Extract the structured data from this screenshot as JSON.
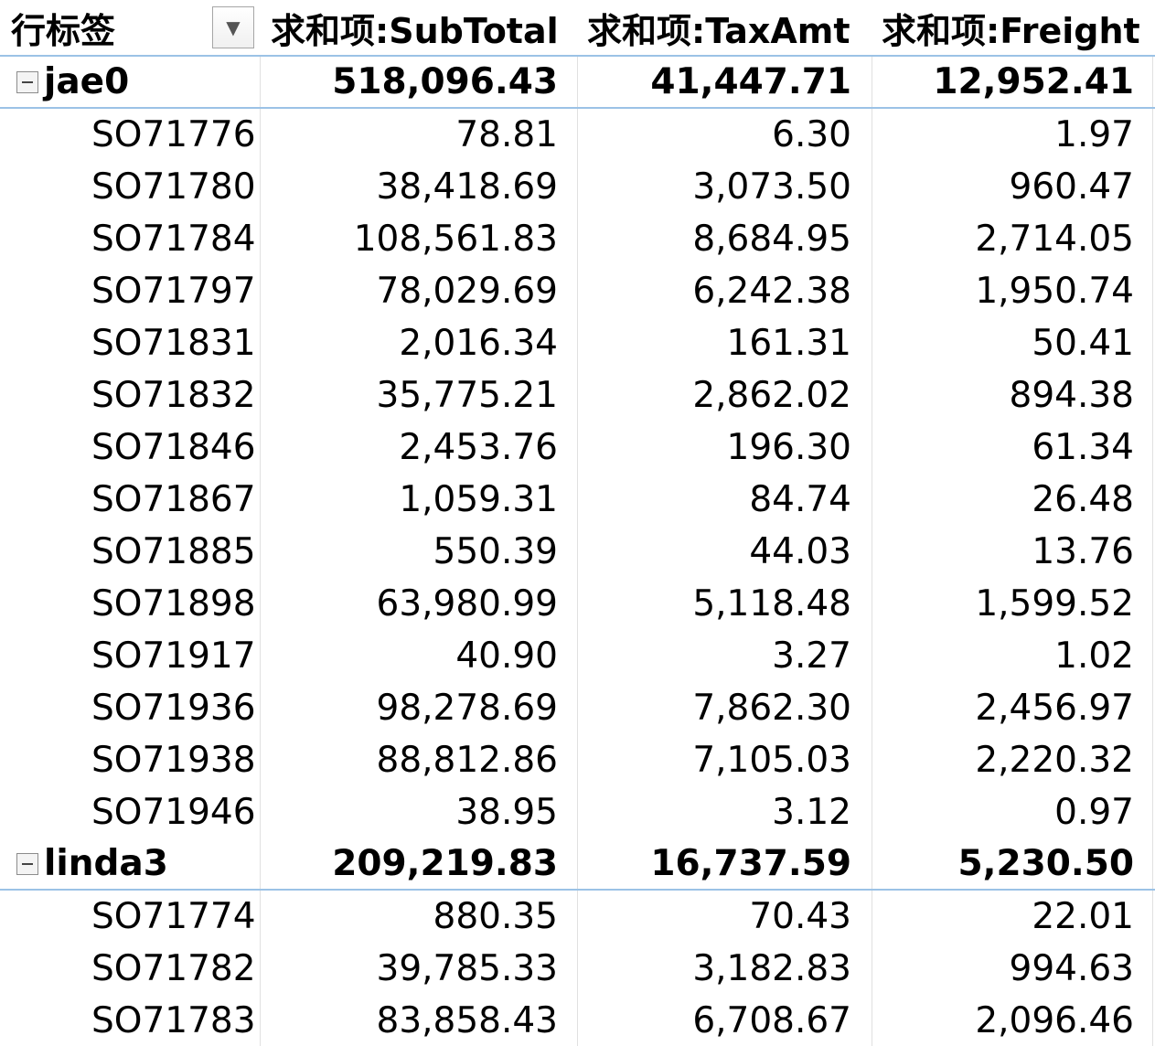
{
  "header": {
    "row_label": "行标签",
    "col1": "求和项:SubTotal",
    "col2": "求和项:TaxAmt",
    "col3": "求和项:Freight"
  },
  "groups": [
    {
      "name": "jae0",
      "subtotal": "518,096.43",
      "tax": "41,447.71",
      "freight": "12,952.41",
      "rows": [
        {
          "id": "SO71776",
          "subtotal": "78.81",
          "tax": "6.30",
          "freight": "1.97"
        },
        {
          "id": "SO71780",
          "subtotal": "38,418.69",
          "tax": "3,073.50",
          "freight": "960.47"
        },
        {
          "id": "SO71784",
          "subtotal": "108,561.83",
          "tax": "8,684.95",
          "freight": "2,714.05"
        },
        {
          "id": "SO71797",
          "subtotal": "78,029.69",
          "tax": "6,242.38",
          "freight": "1,950.74"
        },
        {
          "id": "SO71831",
          "subtotal": "2,016.34",
          "tax": "161.31",
          "freight": "50.41"
        },
        {
          "id": "SO71832",
          "subtotal": "35,775.21",
          "tax": "2,862.02",
          "freight": "894.38"
        },
        {
          "id": "SO71846",
          "subtotal": "2,453.76",
          "tax": "196.30",
          "freight": "61.34"
        },
        {
          "id": "SO71867",
          "subtotal": "1,059.31",
          "tax": "84.74",
          "freight": "26.48"
        },
        {
          "id": "SO71885",
          "subtotal": "550.39",
          "tax": "44.03",
          "freight": "13.76"
        },
        {
          "id": "SO71898",
          "subtotal": "63,980.99",
          "tax": "5,118.48",
          "freight": "1,599.52"
        },
        {
          "id": "SO71917",
          "subtotal": "40.90",
          "tax": "3.27",
          "freight": "1.02"
        },
        {
          "id": "SO71936",
          "subtotal": "98,278.69",
          "tax": "7,862.30",
          "freight": "2,456.97"
        },
        {
          "id": "SO71938",
          "subtotal": "88,812.86",
          "tax": "7,105.03",
          "freight": "2,220.32"
        },
        {
          "id": "SO71946",
          "subtotal": "38.95",
          "tax": "3.12",
          "freight": "0.97"
        }
      ]
    },
    {
      "name": "linda3",
      "subtotal": "209,219.83",
      "tax": "16,737.59",
      "freight": "5,230.50",
      "rows": [
        {
          "id": "SO71774",
          "subtotal": "880.35",
          "tax": "70.43",
          "freight": "22.01"
        },
        {
          "id": "SO71782",
          "subtotal": "39,785.33",
          "tax": "3,182.83",
          "freight": "994.63"
        },
        {
          "id": "SO71783",
          "subtotal": "83,858.43",
          "tax": "6,708.67",
          "freight": "2,096.46"
        }
      ]
    }
  ]
}
